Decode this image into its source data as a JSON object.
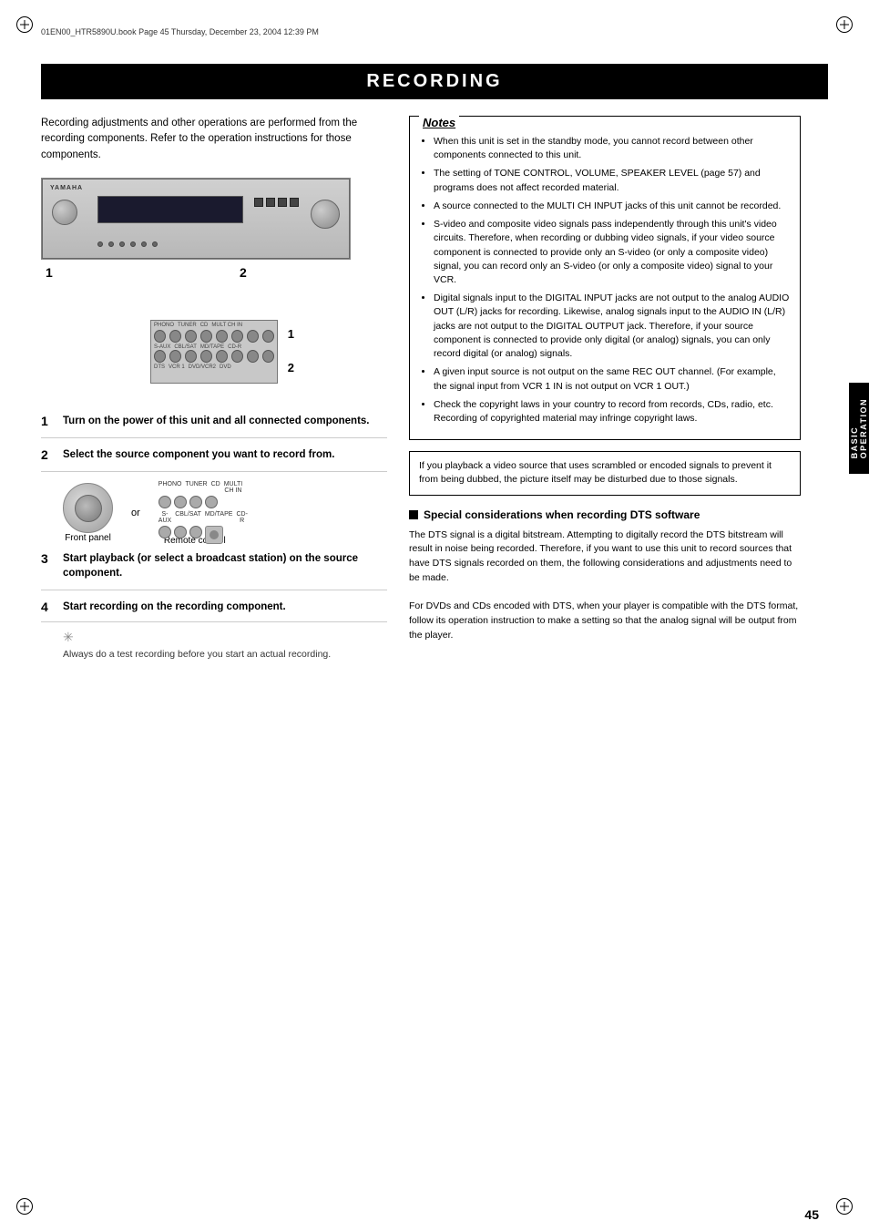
{
  "file_path": "01EN00_HTR5890U.book  Page 45  Thursday, December 23, 2004  12:39 PM",
  "title": "RECORDING",
  "intro": "Recording adjustments and other operations are performed from the recording components. Refer to the operation instructions for those components.",
  "main_label_1": "1",
  "main_label_2": "2",
  "rear_label_1": "1",
  "rear_label_2": "2",
  "steps": [
    {
      "num": "1",
      "text": "Turn on the power of this unit and all connected components."
    },
    {
      "num": "2",
      "text": "Select the source component you want to record from."
    },
    {
      "num": "3",
      "text": "Start playback (or select a broadcast station) on the source component."
    },
    {
      "num": "4",
      "text": "Start recording on the recording component."
    }
  ],
  "front_panel_label": "Front panel",
  "remote_control_label": "Remote control",
  "or_label": "or",
  "tip_text": "Always do a test recording before you start an actual recording.",
  "notes_title": "Notes",
  "notes_items": [
    "When this unit is set in the standby mode, you cannot record between other components connected to this unit.",
    "The setting of TONE CONTROL, VOLUME, SPEAKER LEVEL (page 57) and programs does not affect recorded material.",
    "A source connected to the MULTI CH INPUT jacks of this unit cannot be recorded.",
    "S-video and composite video signals pass independently through this unit's video circuits. Therefore, when recording or dubbing video signals, if your video source component is connected to provide only an S-video (or only a composite video) signal, you can record only an S-video (or only a composite video) signal to your VCR.",
    "Digital signals input to the DIGITAL INPUT jacks are not output to the analog AUDIO OUT (L/R) jacks for recording. Likewise, analog signals input to the AUDIO IN (L/R) jacks are not output to the DIGITAL OUTPUT jack. Therefore, if your source component is connected to provide only digital (or analog) signals, you can only record digital (or analog) signals.",
    "A given input source is not output on the same REC OUT channel. (For example, the signal input from VCR 1 IN is not output on VCR 1 OUT.)",
    "Check the copyright laws in your country to record from records, CDs, radio, etc. Recording of copyrighted material may infringe copyright laws."
  ],
  "warning_text": "If you playback a video source that uses scrambled or encoded signals to prevent it from being dubbed, the picture itself may be disturbed due to those signals.",
  "special_heading": "Special considerations when recording DTS software",
  "special_text": "The DTS signal is a digital bitstream. Attempting to digitally record the DTS bitstream will result in noise being recorded. Therefore, if you want to use this unit to record sources that have DTS signals recorded on them, the following considerations and adjustments need to be made.\nFor DVDs and CDs encoded with DTS, when your player is compatible with the DTS format, follow its operation instruction to make a setting so that the analog signal will be output from the player.",
  "sidebar_line1": "BASIC",
  "sidebar_line2": "OPERATION",
  "page_number": "45"
}
